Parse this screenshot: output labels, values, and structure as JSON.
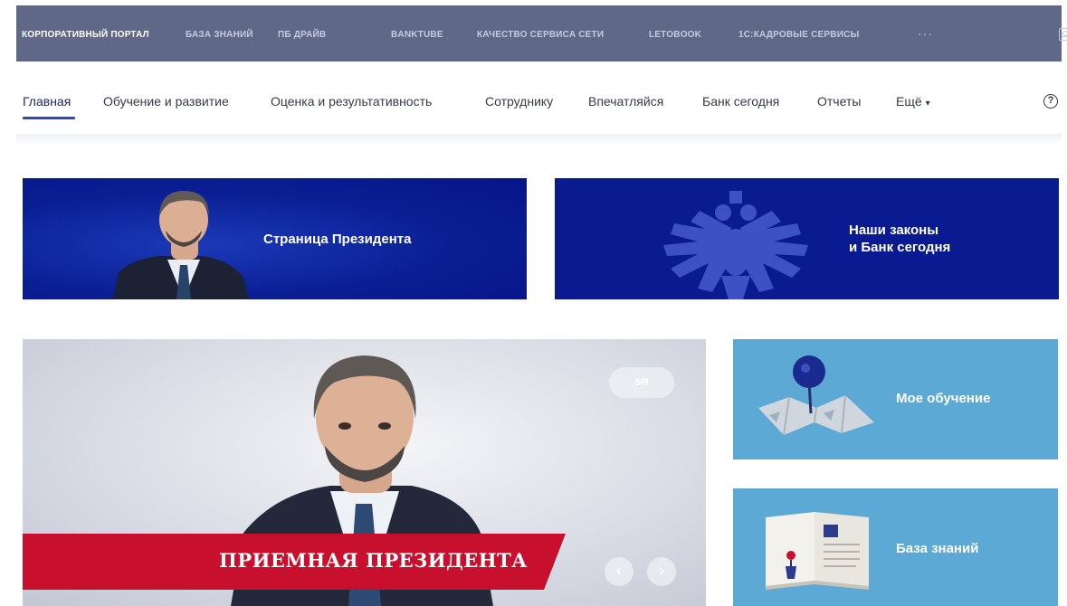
{
  "topbar": {
    "links": [
      {
        "label": "КОРПОРАТИВНЫЙ ПОРТАЛ"
      },
      {
        "label": "БАЗА ЗНАНИЙ"
      },
      {
        "label": "ПБ ДРАЙВ"
      },
      {
        "label": "BANKTUBE"
      },
      {
        "label": "КАЧЕСТВО СЕРВИСА СЕТИ"
      },
      {
        "label": "LETOBOOK"
      },
      {
        "label": "1С:КАДРОВЫЕ СЕРВИСЫ"
      }
    ],
    "more_label": "···",
    "user_icon": "user-card-icon"
  },
  "nav": {
    "items": [
      {
        "label": "Главная"
      },
      {
        "label": "Обучение и развитие"
      },
      {
        "label": "Оценка и результативность"
      },
      {
        "label": "Сотруднику"
      },
      {
        "label": "Впечатляйся"
      },
      {
        "label": "Банк сегодня"
      },
      {
        "label": "Отчеты"
      },
      {
        "label": "Ещё"
      }
    ],
    "more_caret": "▾",
    "help_glyph": "?"
  },
  "banners": {
    "president": {
      "label": "Страница Президента"
    },
    "laws": {
      "line1": "Наши законы",
      "line2": "и Банк сегодня"
    }
  },
  "slider": {
    "counter": "5/8",
    "caption": "ПРИЕМНАЯ ПРЕЗИДЕНТА",
    "prev_glyph": "‹",
    "next_glyph": "›"
  },
  "tiles": {
    "learning": {
      "label": "Мое обучение"
    },
    "knowledge": {
      "label": "База знаний"
    }
  },
  "colors": {
    "topbar": "#5f6886",
    "banner": "#0a1a90",
    "accent_red": "#c8102e",
    "tile": "#5da9d6"
  }
}
